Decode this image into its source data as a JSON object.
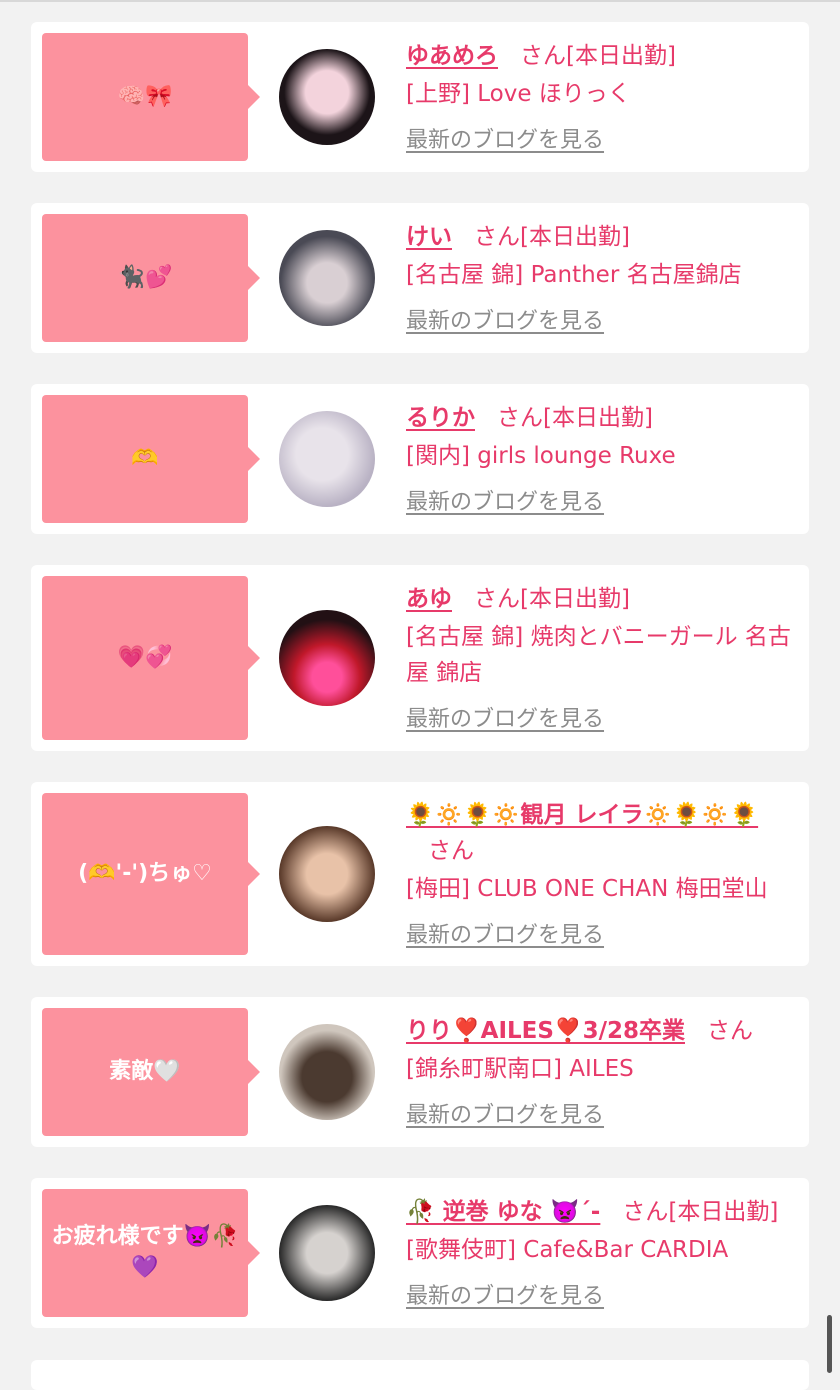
{
  "blog_link_label": "最新のブログを見る",
  "honorific": "さん",
  "cards": [
    {
      "message": "🧠🎀",
      "name": "ゆあめろ",
      "status": "[本日出勤]",
      "shop": "[上野] Love ほりっく",
      "avatar_colors": [
        "#1c1418",
        "#f3d3dc"
      ],
      "bubble_h": 128
    },
    {
      "message": "🐈‍⬛💕",
      "name": "けい",
      "status": "[本日出勤]",
      "shop": "[名古屋 錦] Panther 名古屋錦店",
      "avatar_colors": [
        "#4a4a55",
        "#d9cfd3"
      ],
      "bubble_h": 128
    },
    {
      "message": "🫶",
      "name": "るりか",
      "status": "[本日出勤]",
      "shop": "[関内] girls lounge Ruxe",
      "avatar_colors": [
        "#b9b2c4",
        "#e8e3ea"
      ],
      "bubble_h": 128
    },
    {
      "message": "💗💞",
      "name": "あゆ",
      "status": "[本日出勤]",
      "shop": "[名古屋 錦] 焼肉とバニーガール 名古屋 錦店",
      "avatar_colors": [
        "#221014",
        "#c0182a"
      ],
      "bubble_h": 164
    },
    {
      "message": "(🫶'-')ちゅ♡",
      "name": "🌻🔅🌻🔅観月 レイラ🔅🌻🔅🌻",
      "status": "",
      "shop": "[梅田] CLUB ONE CHAN 梅田堂山",
      "avatar_colors": [
        "#5a3a2a",
        "#e8c2a8"
      ],
      "bubble_h": 162
    },
    {
      "message": "素敵🤍",
      "name": "りり❣️AILES❣️3/28卒業",
      "status": "",
      "shop": "[錦糸町駅南口] AILES",
      "avatar_colors": [
        "#4b3a30",
        "#cfc6bd"
      ],
      "bubble_h": 128
    },
    {
      "message": "お疲れ様です👿🥀💜",
      "name": "🥀 逆巻 ゆな 👿´-",
      "status": "[本日出勤]",
      "shop": "[歌舞伎町] Cafe&Bar CARDIA",
      "avatar_colors": [
        "#2a2a2a",
        "#d6d2cf"
      ],
      "bubble_h": 128
    }
  ]
}
